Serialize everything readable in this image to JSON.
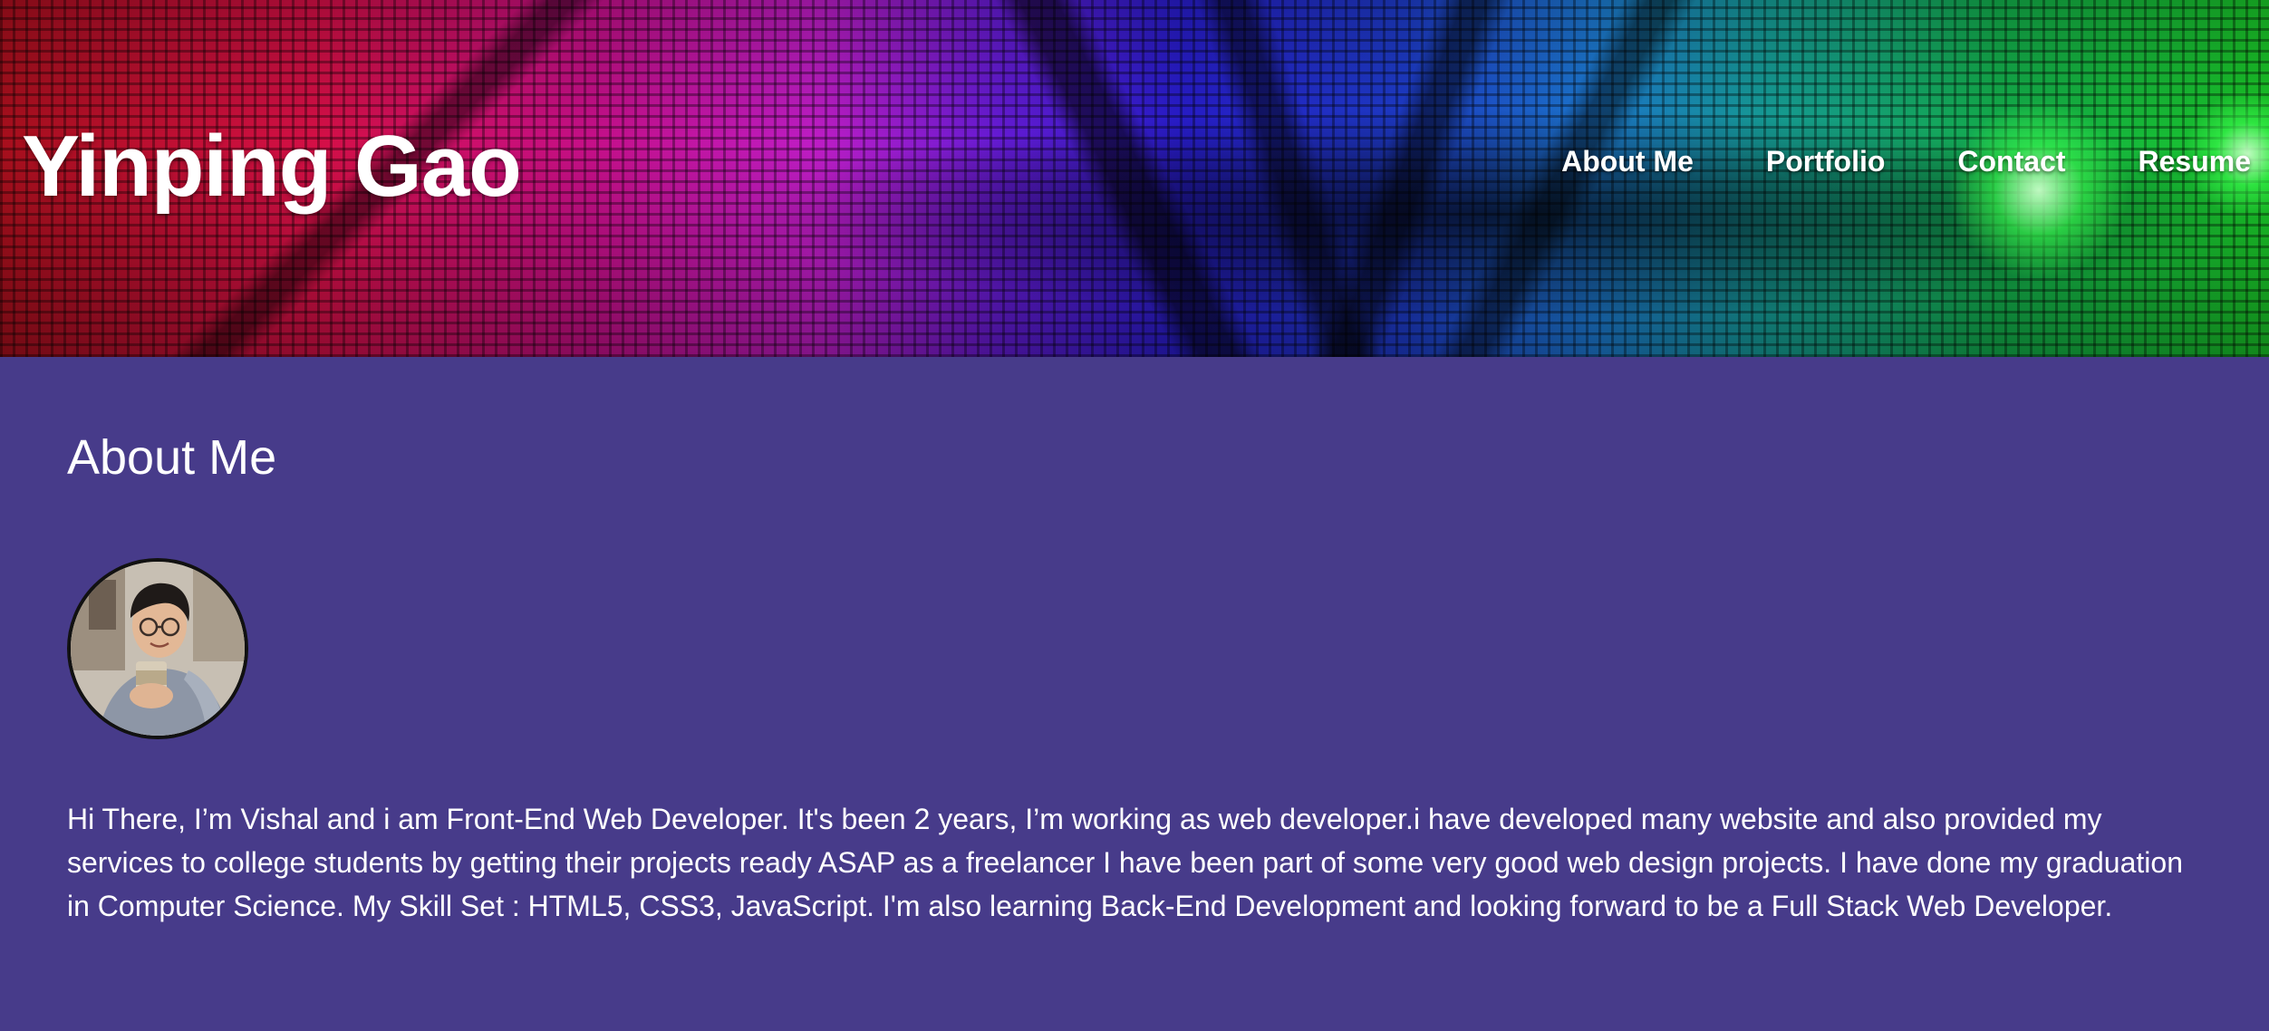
{
  "site": {
    "title": "Yinping Gao"
  },
  "nav": {
    "items": [
      {
        "label": "About Me"
      },
      {
        "label": "Portfolio"
      },
      {
        "label": "Contact"
      },
      {
        "label": "Resume"
      }
    ]
  },
  "about": {
    "heading": "About Me",
    "avatar_alt": "profile photo",
    "body": "Hi There, I’m Vishal and i am Front-End Web Developer. It's been 2 years, I’m working as web developer.i have developed many website and also provided my services to college students by getting their projects ready ASAP as a freelancer I have been part of some very good web design projects. I have done my graduation in Computer Science. My Skill Set : HTML5, CSS3, JavaScript. I'm also learning Back-End Development and looking forward to be a Full Stack Web Developer."
  },
  "colors": {
    "page_background": "#473b8a",
    "text": "#ffffff"
  }
}
